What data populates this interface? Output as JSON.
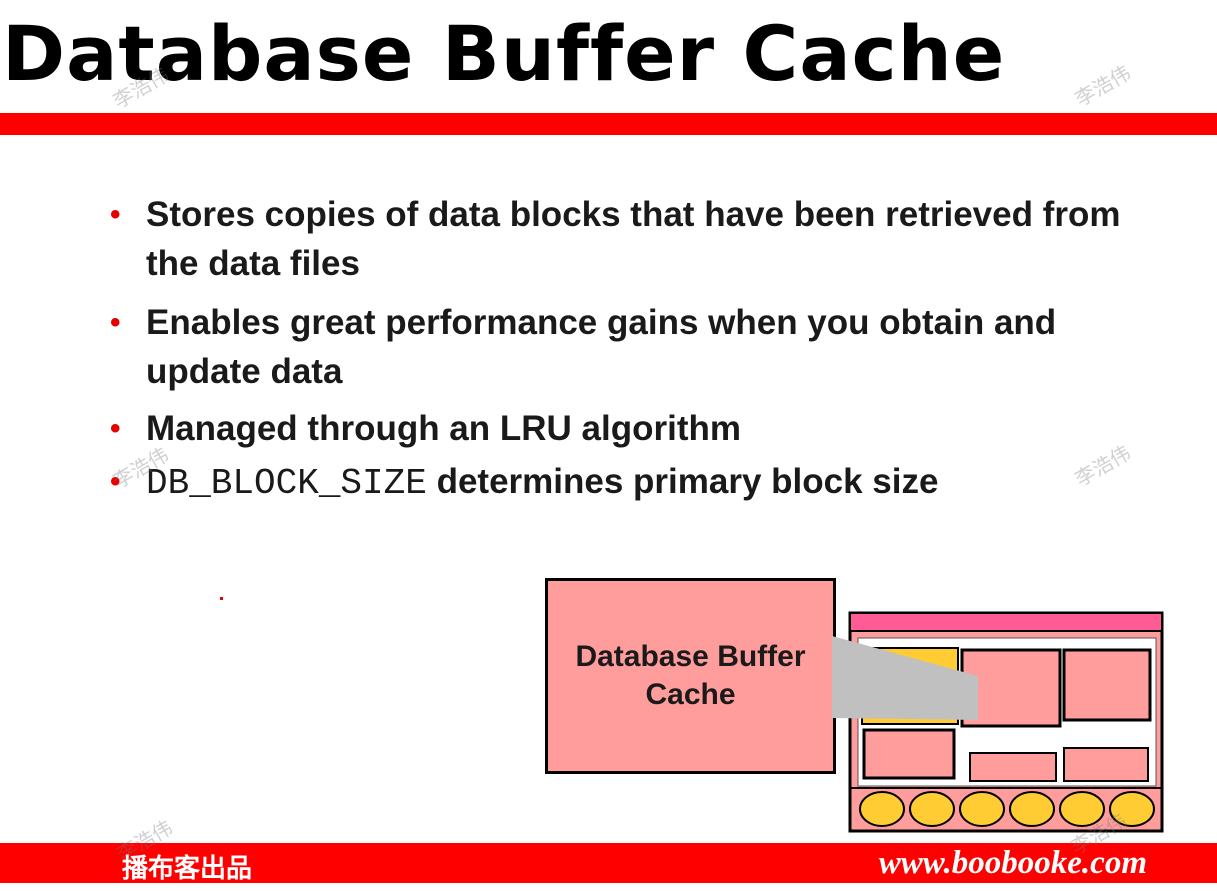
{
  "slide": {
    "title": "Database Buffer Cache",
    "bullets": [
      {
        "text": "Stores copies of data blocks that have been retrieved from the data files"
      },
      {
        "text": "Enables great performance gains when you obtain and update data"
      },
      {
        "text": "Managed through an LRU algorithm"
      },
      {
        "code": "DB_BLOCK_SIZE",
        "text": " determines primary block size"
      }
    ]
  },
  "diagram": {
    "label_line1": "Database Buffer",
    "label_line2": "Cache",
    "colors": {
      "label_fill": "#ff9c9c",
      "sga_header": "#ff5c96",
      "sga_body": "#ff9c9c",
      "buffer_block": "#ffffff",
      "highlight_block": "#ffcc33",
      "callout_wedge": "#c0c0c0",
      "circle_fill": "#ffcc33"
    }
  },
  "footer": {
    "left_text": "播布客出品",
    "right_text": "www.boobooke.com"
  },
  "watermark": "李浩伟",
  "colors": {
    "accent_red": "#ff0000",
    "bullet_red": "#e60000"
  }
}
